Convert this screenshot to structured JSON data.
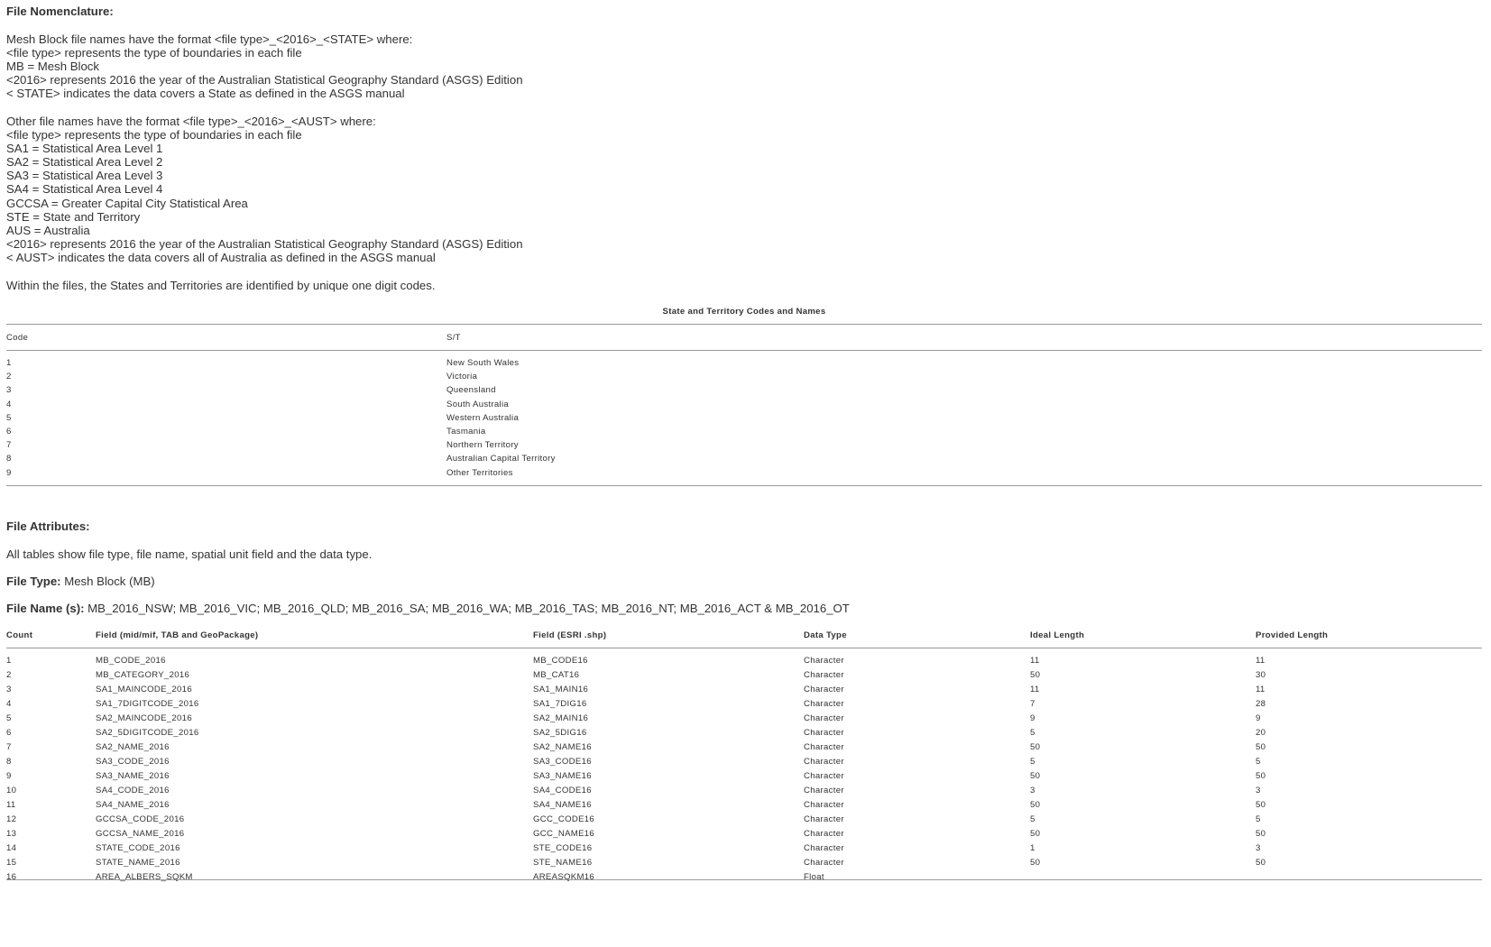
{
  "nomenclature": {
    "heading": "File Nomenclature:",
    "mb_intro": "Mesh Block file names have the format <file type>_<2016>_<STATE> where:",
    "mb_lines": [
      "<file type> represents the type of boundaries in each file",
      "MB = Mesh Block",
      "<2016> represents 2016 the year of the Australian Statistical Geography Standard (ASGS) Edition",
      "< STATE> indicates the data covers a State as defined in the ASGS manual"
    ],
    "other_intro": "Other file names have the format <file type>_<2016>_<AUST> where:",
    "other_lines": [
      "<file type> represents the type of boundaries in each file",
      "SA1 = Statistical Area Level 1",
      "SA2 = Statistical Area Level 2",
      "SA3 = Statistical Area Level 3",
      "SA4 = Statistical Area Level 4",
      "GCCSA = Greater Capital City Statistical Area",
      "STE = State and Territory",
      "AUS = Australia",
      "<2016> represents 2016 the year of the Australian Statistical Geography Standard (ASGS) Edition",
      "< AUST> indicates the data covers all of Australia as defined in the ASGS manual"
    ],
    "within_text": "Within the files, the States and Territories are identified by unique one digit codes."
  },
  "state_table": {
    "caption": "State and Territory Codes and Names",
    "headers": [
      "Code",
      "S/T"
    ],
    "rows": [
      [
        "1",
        "New South Wales"
      ],
      [
        "2",
        "Victoria"
      ],
      [
        "3",
        "Queensland"
      ],
      [
        "4",
        "South Australia"
      ],
      [
        "5",
        "Western Australia"
      ],
      [
        "6",
        "Tasmania"
      ],
      [
        "7",
        "Northern Territory"
      ],
      [
        "8",
        "Australian Capital Territory"
      ],
      [
        "9",
        "Other Territories"
      ]
    ]
  },
  "attributes": {
    "heading": "File Attributes:",
    "intro": "All tables show file type, file name, spatial unit field and the data type.",
    "file_type_label": "File Type:",
    "file_type_value": " Mesh Block (MB)",
    "file_name_label": "File Name (s):",
    "file_name_value": " MB_2016_NSW; MB_2016_VIC; MB_2016_QLD; MB_2016_SA; MB_2016_WA; MB_2016_TAS; MB_2016_NT; MB_2016_ACT & MB_2016_OT"
  },
  "field_table": {
    "headers": [
      "Count",
      "Field (mid/mif, TAB and GeoPackage)",
      "Field (ESRI .shp)",
      "Data Type",
      "Ideal Length",
      "Provided Length"
    ],
    "rows": [
      [
        "1",
        "MB_CODE_2016",
        "MB_CODE16",
        "Character",
        "11",
        "11"
      ],
      [
        "2",
        "MB_CATEGORY_2016",
        "MB_CAT16",
        "Character",
        "50",
        "30"
      ],
      [
        "3",
        "SA1_MAINCODE_2016",
        "SA1_MAIN16",
        "Character",
        "11",
        "11"
      ],
      [
        "4",
        "SA1_7DIGITCODE_2016",
        "SA1_7DIG16",
        "Character",
        "7",
        "28"
      ],
      [
        "5",
        "SA2_MAINCODE_2016",
        "SA2_MAIN16",
        "Character",
        "9",
        "9"
      ],
      [
        "6",
        "SA2_5DIGITCODE_2016",
        "SA2_5DIG16",
        "Character",
        "5",
        "20"
      ],
      [
        "7",
        "SA2_NAME_2016",
        "SA2_NAME16",
        "Character",
        "50",
        "50"
      ],
      [
        "8",
        "SA3_CODE_2016",
        "SA3_CODE16",
        "Character",
        "5",
        "5"
      ],
      [
        "9",
        "SA3_NAME_2016",
        "SA3_NAME16",
        "Character",
        "50",
        "50"
      ],
      [
        "10",
        "SA4_CODE_2016",
        "SA4_CODE16",
        "Character",
        "3",
        "3"
      ],
      [
        "11",
        "SA4_NAME_2016",
        "SA4_NAME16",
        "Character",
        "50",
        "50"
      ],
      [
        "12",
        "GCCSA_CODE_2016",
        "GCC_CODE16",
        "Character",
        "5",
        "5"
      ],
      [
        "13",
        "GCCSA_NAME_2016",
        "GCC_NAME16",
        "Character",
        "50",
        "50"
      ],
      [
        "14",
        "STATE_CODE_2016",
        "STE_CODE16",
        "Character",
        "1",
        "3"
      ],
      [
        "15",
        "STATE_NAME_2016",
        "STE_NAME16",
        "Character",
        "50",
        "50"
      ],
      [
        "16",
        "AREA_ALBERS_SQKM",
        "AREASQKM16",
        "Float",
        "",
        ""
      ]
    ]
  }
}
